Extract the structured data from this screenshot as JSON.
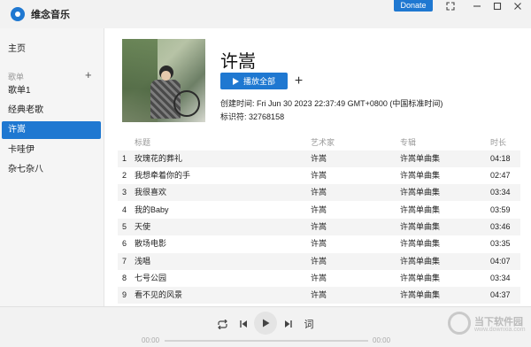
{
  "app": {
    "title": "维念音乐",
    "donate_label": "Donate"
  },
  "sidebar": {
    "home": "主页",
    "section_label": "歌单",
    "add_label": "+",
    "items": [
      {
        "label": "歌单1"
      },
      {
        "label": "经典老歌"
      },
      {
        "label": "许嵩",
        "active": true
      },
      {
        "label": "卡哇伊"
      },
      {
        "label": "杂七杂八"
      }
    ]
  },
  "playlist": {
    "title": "许嵩",
    "play_all_label": "播放全部",
    "add_label": "+",
    "created_label": "创建时间:",
    "created_value": "Fri Jun 30 2023 22:37:49 GMT+0800 (中国标准时间)",
    "id_label": "标识符:",
    "id_value": "32768158"
  },
  "table": {
    "headers": {
      "title": "标题",
      "artist": "艺术家",
      "album": "专辑",
      "duration": "时长"
    },
    "rows": [
      {
        "index": "1",
        "title": "玫瑰花的葬礼",
        "artist": "许嵩",
        "album": "许嵩单曲集",
        "duration": "04:18"
      },
      {
        "index": "2",
        "title": "我想牵着你的手",
        "artist": "许嵩",
        "album": "许嵩单曲集",
        "duration": "02:47"
      },
      {
        "index": "3",
        "title": "我很喜欢",
        "artist": "许嵩",
        "album": "许嵩单曲集",
        "duration": "03:34"
      },
      {
        "index": "4",
        "title": "我的Baby",
        "artist": "许嵩",
        "album": "许嵩单曲集",
        "duration": "03:59"
      },
      {
        "index": "5",
        "title": "天使",
        "artist": "许嵩",
        "album": "许嵩单曲集",
        "duration": "03:46"
      },
      {
        "index": "6",
        "title": "散场电影",
        "artist": "许嵩",
        "album": "许嵩单曲集",
        "duration": "03:35"
      },
      {
        "index": "7",
        "title": "浅唱",
        "artist": "许嵩",
        "album": "许嵩单曲集",
        "duration": "04:07"
      },
      {
        "index": "8",
        "title": "七号公园",
        "artist": "许嵩",
        "album": "许嵩单曲集",
        "duration": "03:34"
      },
      {
        "index": "9",
        "title": "看不见的风景",
        "artist": "许嵩",
        "album": "许嵩单曲集",
        "duration": "04:37"
      }
    ]
  },
  "player": {
    "elapsed": "00:00",
    "total": "00:00",
    "lyrics_label": "词",
    "progress_fraction": 0
  },
  "watermark": {
    "name": "当下软件园",
    "url": "www.downxia.com"
  },
  "icons": {
    "logo": "app-logo-icon",
    "fullscreen": "fullscreen-icon",
    "minimize": "minimize-icon",
    "maximize": "maximize-icon",
    "close": "close-icon",
    "repeat": "repeat-icon",
    "prev": "previous-icon",
    "play": "play-icon",
    "next": "next-icon"
  },
  "colors": {
    "accent": "#1f78d1"
  }
}
